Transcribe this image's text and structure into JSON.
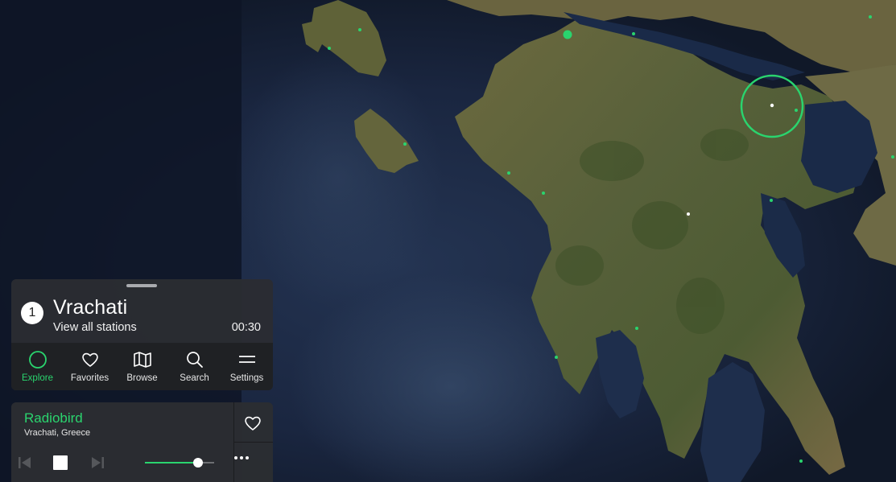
{
  "station_panel": {
    "station_count": "1",
    "station_name": "Vrachati",
    "view_all_label": "View all stations",
    "timer": "00:30"
  },
  "nav": {
    "items": [
      {
        "label": "Explore",
        "icon": "explore-circle-icon",
        "active": true
      },
      {
        "label": "Favorites",
        "icon": "heart-icon",
        "active": false
      },
      {
        "label": "Browse",
        "icon": "map-icon",
        "active": false
      },
      {
        "label": "Search",
        "icon": "search-icon",
        "active": false
      },
      {
        "label": "Settings",
        "icon": "menu-icon",
        "active": false
      }
    ]
  },
  "player": {
    "station_name": "Radiobird",
    "location": "Vrachati, Greece",
    "volume": 0.77
  },
  "colors": {
    "accent": "#2ad46e",
    "panel": "#2b2d32",
    "nav_bar": "#1f2124"
  }
}
